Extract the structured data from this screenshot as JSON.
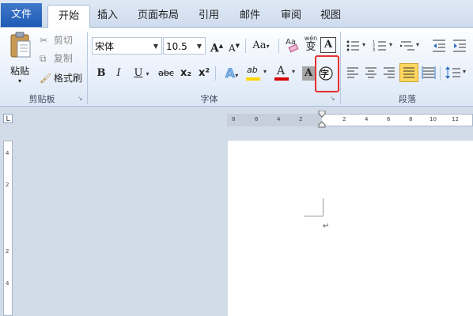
{
  "tabs": {
    "file": "文件",
    "items": [
      "开始",
      "插入",
      "页面布局",
      "引用",
      "邮件",
      "审阅",
      "视图"
    ]
  },
  "clipboard": {
    "paste": "粘贴",
    "cut": "剪切",
    "copy": "复制",
    "format_painter": "格式刷",
    "group_label": "剪贴板"
  },
  "font": {
    "font_name": "宋体",
    "font_size": "10.5",
    "group_label": "字体",
    "grow_label": "A",
    "shrink_label": "A",
    "case_label": "Aa",
    "phonetic_label": "wén",
    "phonetic_char": "变",
    "border_label": "A",
    "bold": "B",
    "italic": "I",
    "underline": "U",
    "strike": "abc",
    "subscript": "x₂",
    "superscript": "x²",
    "effects": "A",
    "highlight": "ab",
    "font_color": "A",
    "shading": "A",
    "enclose": "字"
  },
  "paragraph": {
    "group_label": "段落"
  },
  "ruler": {
    "top_numbers": [
      "8",
      "6",
      "4",
      "2",
      "2",
      "4",
      "6",
      "8",
      "10",
      "12"
    ],
    "side_numbers": [
      "4",
      "2",
      "2",
      "4"
    ],
    "corner": "L"
  },
  "document": {
    "paragraph_mark": "↵"
  },
  "colors": {
    "accent": "#1f5bb4",
    "highlight_red": "#e53030",
    "highlight_yellow": "#ffd700",
    "font_red": "#d40000",
    "selected_align": "#ffd65e"
  }
}
